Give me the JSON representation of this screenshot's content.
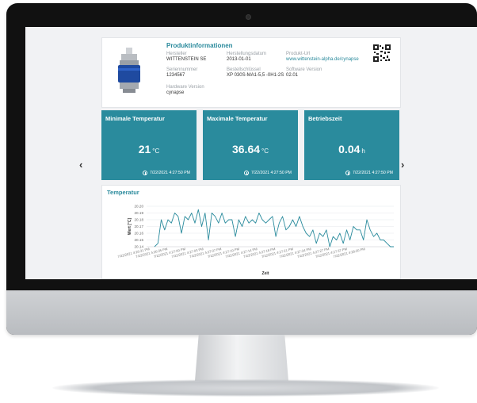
{
  "product": {
    "title": "Produktinformationen",
    "fields": [
      {
        "label": "Hersteller",
        "value": "WITTENSTEIN SE",
        "link": false
      },
      {
        "label": "Herstellungsdatum",
        "value": "2013-01-01",
        "link": false
      },
      {
        "label": "Produkt-Url",
        "value": "www.wittenstein-alpha.de/cynapse",
        "link": true
      },
      {
        "label": "Seriennummer",
        "value": "1234567",
        "link": false
      },
      {
        "label": "Bestellschlüssel",
        "value": "XP 030S-MA1-5,5 -0H1-2S",
        "link": false
      },
      {
        "label": "Software Version",
        "value": "02.01",
        "link": false
      },
      {
        "label": "Hardware Version",
        "value": "cynapse",
        "link": false
      }
    ]
  },
  "tiles": [
    {
      "title": "Minimale Temperatur",
      "value": "21",
      "unit": "°C",
      "time": "7/22/2021 4:27:50 PM"
    },
    {
      "title": "Maximale Temperatur",
      "value": "36.64",
      "unit": "°C",
      "time": "7/22/2021 4:27:50 PM"
    },
    {
      "title": "Betriebszeit",
      "value": "0.04",
      "unit": "h",
      "time": "7/22/2021 4:27:50 PM"
    }
  ],
  "chart": {
    "title": "Temperatur",
    "ylabel": "Wert [°C]",
    "xlabel": "Zeit"
  },
  "nav": {
    "prev": "‹",
    "next": "›"
  },
  "colors": {
    "accent": "#2a8b9d",
    "tile_bg": "#2a8b9d"
  },
  "chart_data": {
    "type": "line",
    "title": "Temperatur",
    "xlabel": "Zeit",
    "ylabel": "Wert [°C]",
    "ylim": [
      20.14,
      20.2
    ],
    "yticks": [
      "20.20",
      "20.19",
      "20.18",
      "20.17",
      "20.16",
      "20.15",
      "20.14"
    ],
    "xticks": [
      "7/22/2021 4:26:31 PM",
      "7/22/2021 4:26:35 PM",
      "7/22/2021 4:27:00 PM",
      "7/22/2021 4:27:03 PM",
      "7/22/2021 4:27:07 PM",
      "7/22/2021 4:27:10 PM",
      "7/22/2021 4:27:14 PM",
      "7/22/2021 4:27:18 PM",
      "7/22/2021 4:27:21 PM",
      "7/22/2021 4:27:24 PM",
      "7/22/2021 4:27:27 PM",
      "7/22/2021 4:27:37 PM",
      "7/22/2021 4:28:20 PM"
    ],
    "grid": true,
    "series": [
      {
        "values": [
          20.14,
          20.145,
          20.18,
          20.165,
          20.18,
          20.175,
          20.19,
          20.185,
          20.16,
          20.185,
          20.18,
          20.19,
          20.175,
          20.195,
          20.17,
          20.19,
          20.15,
          20.19,
          20.185,
          20.175,
          20.19,
          20.175,
          20.18,
          20.18,
          20.155,
          20.18,
          20.17,
          20.185,
          20.175,
          20.18,
          20.175,
          20.19,
          20.18,
          20.175,
          20.18,
          20.185,
          20.155,
          20.175,
          20.185,
          20.165,
          20.17,
          20.18,
          20.17,
          20.185,
          20.17,
          20.16,
          20.155,
          20.165,
          20.145,
          20.16,
          20.155,
          20.165,
          20.14,
          20.155,
          20.15,
          20.16,
          20.145,
          20.165,
          20.15,
          20.17,
          20.165,
          20.165,
          20.15,
          20.18,
          20.165,
          20.155,
          20.16,
          20.15,
          20.15,
          20.145,
          20.14,
          20.14
        ]
      }
    ]
  }
}
